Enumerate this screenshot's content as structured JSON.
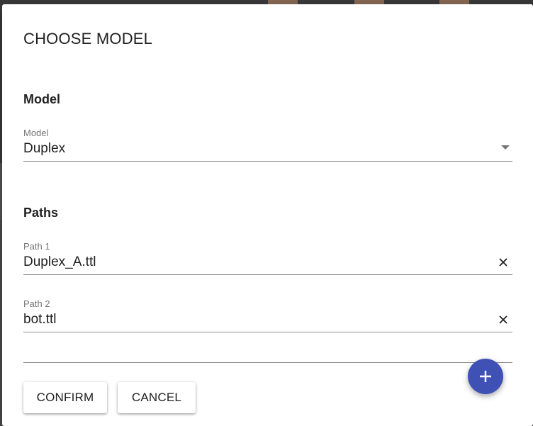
{
  "dialog": {
    "title": "CHOOSE MODEL"
  },
  "model_section": {
    "heading": "Model",
    "field": {
      "label": "Model",
      "value": "Duplex"
    }
  },
  "paths_section": {
    "heading": "Paths",
    "paths": [
      {
        "label": "Path 1",
        "value": "Duplex_A.ttl"
      },
      {
        "label": "Path 2",
        "value": "bot.ttl"
      }
    ]
  },
  "actions": {
    "confirm_label": "CONFIRM",
    "cancel_label": "CANCEL",
    "add_icon": "plus-icon"
  },
  "colors": {
    "accent": "#3f51b5"
  }
}
